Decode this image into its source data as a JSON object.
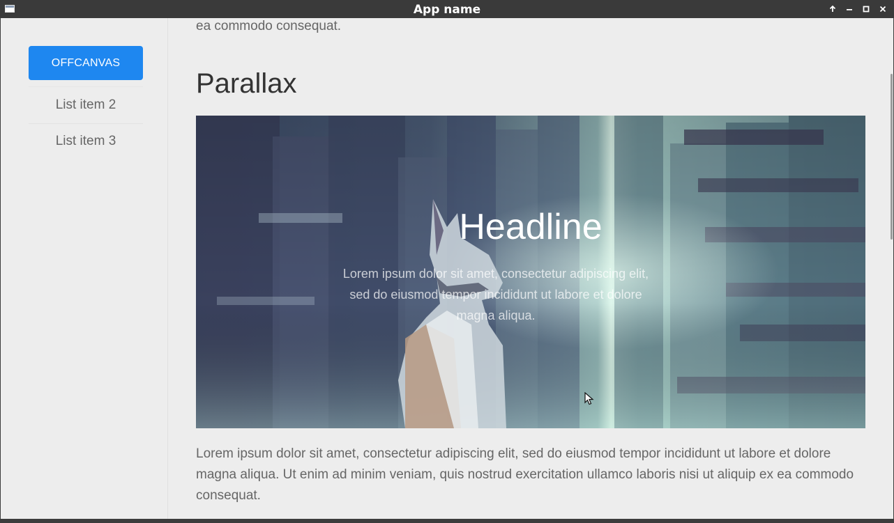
{
  "window": {
    "title": "App name",
    "icons": {
      "app": "app-window-icon",
      "up": "arrow-up-icon",
      "minimize": "minimize-icon",
      "maximize": "maximize-icon",
      "close": "close-icon"
    }
  },
  "sidebar": {
    "button_label": "OFFCANVAS",
    "items": [
      {
        "label": "List item 2"
      },
      {
        "label": "List item 3"
      }
    ]
  },
  "main": {
    "top_text": "ea commodo consequat.",
    "section_title": "Parallax",
    "hero": {
      "headline": "Headline",
      "text": "Lorem ipsum dolor sit amet, consectetur adipiscing elit, sed do eiusmod tempor incididunt ut labore et dolore magna aliqua."
    },
    "body_text": "Lorem ipsum dolor sit amet, consectetur adipiscing elit, sed do eiusmod tempor incididunt ut labore et dolore magna aliqua. Ut enim ad minim veniam, quis nostrud exercitation ullamco laboris nisi ut aliquip ex ea commodo consequat."
  },
  "colors": {
    "accent": "#1e87f0",
    "titlebar": "#3a3a3a",
    "background": "#ededed",
    "text": "#666666",
    "heading": "#333333"
  }
}
